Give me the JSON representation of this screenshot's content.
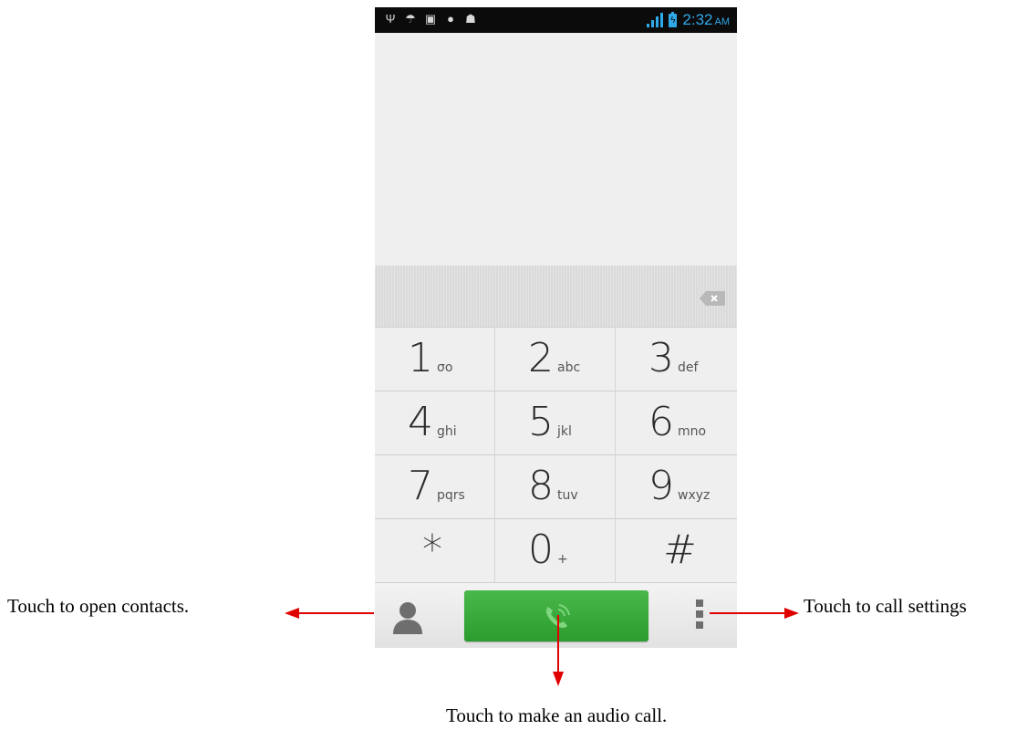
{
  "status_bar": {
    "time": "2:32",
    "ampm": "AM",
    "left_icons": [
      "usb-icon",
      "wifi-icon",
      "message-icon",
      "alert-icon",
      "android-icon"
    ],
    "accent_color": "#2fa8e8"
  },
  "keypad": {
    "keys": [
      {
        "num": "1",
        "letters": "σο"
      },
      {
        "num": "2",
        "letters": "abc"
      },
      {
        "num": "3",
        "letters": "def"
      },
      {
        "num": "4",
        "letters": "ghi"
      },
      {
        "num": "5",
        "letters": "jkl"
      },
      {
        "num": "6",
        "letters": "mno"
      },
      {
        "num": "7",
        "letters": "pqrs"
      },
      {
        "num": "8",
        "letters": "tuv"
      },
      {
        "num": "9",
        "letters": "wxyz"
      },
      {
        "num": "*",
        "letters": ""
      },
      {
        "num": "0",
        "letters": "+"
      },
      {
        "num": "#",
        "letters": ""
      }
    ]
  },
  "bottom_bar": {
    "call_button_color": "#3aab3c",
    "icons": [
      "contacts-icon",
      "phone-icon",
      "overflow-menu-icon"
    ]
  },
  "annotations": {
    "contacts": "Touch to open contacts.",
    "settings": "Touch to call settings",
    "call": "Touch to make an audio call."
  }
}
